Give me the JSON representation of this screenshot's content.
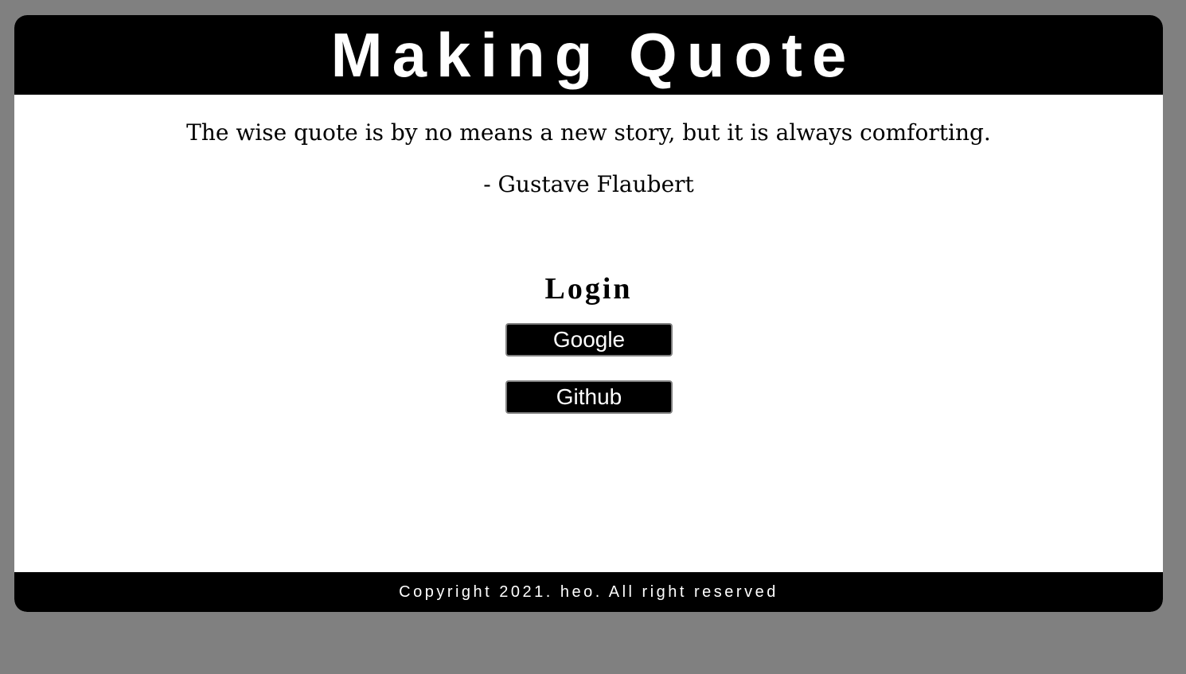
{
  "header": {
    "title": "Making Quote"
  },
  "quote": {
    "text": "The wise quote is by no means a new story, but it is always comforting.",
    "author": "- Gustave Flaubert"
  },
  "login": {
    "heading": "Login",
    "google_label": "Google",
    "github_label": "Github"
  },
  "footer": {
    "copyright": "Copyright 2021. heo. All right reserved"
  },
  "colors": {
    "page_background": "#808080",
    "header_background": "#000000",
    "card_background": "#ffffff",
    "button_background": "#000000",
    "button_text": "#ffffff"
  }
}
